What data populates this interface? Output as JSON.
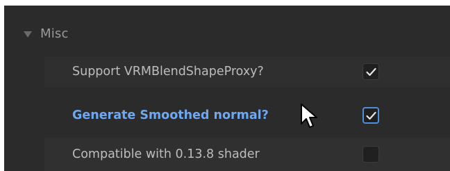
{
  "section": {
    "title": "Misc",
    "expanded": true
  },
  "rows": [
    {
      "label": "Support VRMBlendShapeProxy?",
      "checked": true,
      "highlighted": false
    },
    {
      "label": "Generate Smoothed normal?",
      "checked": true,
      "highlighted": true
    },
    {
      "label": "Compatible with 0.13.8 shader",
      "checked": false,
      "highlighted": false
    }
  ],
  "colors": {
    "panel_bg": "#2b2b2b",
    "label": "#bdbdbd",
    "highlight_label": "#6fa8ef",
    "focus_border": "#4f8fe0",
    "checkmark": "#e6e6e6"
  },
  "icons": {
    "expand": "triangle-down-icon",
    "check": "checkmark-icon",
    "cursor": "mouse-pointer-icon"
  }
}
